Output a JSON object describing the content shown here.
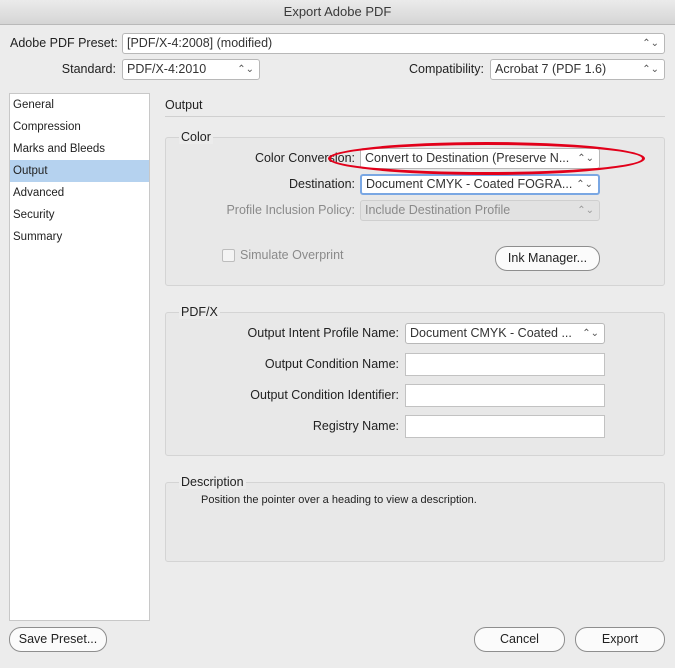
{
  "window": {
    "title": "Export Adobe PDF"
  },
  "header": {
    "preset_label": "Adobe PDF Preset:",
    "preset_value": "[PDF/X-4:2008] (modified)",
    "standard_label": "Standard:",
    "standard_value": "PDF/X-4:2010",
    "compat_label": "Compatibility:",
    "compat_value": "Acrobat 7 (PDF 1.6)"
  },
  "sidebar": {
    "items": [
      {
        "label": "General"
      },
      {
        "label": "Compression"
      },
      {
        "label": "Marks and Bleeds"
      },
      {
        "label": "Output"
      },
      {
        "label": "Advanced"
      },
      {
        "label": "Security"
      },
      {
        "label": "Summary"
      }
    ],
    "selected": "Output"
  },
  "main": {
    "section_title": "Output",
    "color": {
      "title": "Color",
      "conversion_label": "Color Conversion:",
      "conversion_value": "Convert to Destination (Preserve N...",
      "destination_label": "Destination:",
      "destination_value": "Document CMYK - Coated FOGRA...",
      "policy_label": "Profile Inclusion Policy:",
      "policy_value": "Include Destination Profile",
      "simulate_label": "Simulate Overprint",
      "ink_manager_label": "Ink Manager..."
    },
    "pdfx": {
      "title": "PDF/X",
      "intent_label": "Output Intent Profile Name:",
      "intent_value": "Document CMYK - Coated ...",
      "condition_name_label": "Output Condition Name:",
      "condition_name_value": "",
      "condition_id_label": "Output Condition Identifier:",
      "condition_id_value": "",
      "registry_label": "Registry Name:",
      "registry_value": ""
    },
    "description": {
      "title": "Description",
      "text": "Position the pointer over a heading to view a description."
    }
  },
  "footer": {
    "save_preset_label": "Save Preset...",
    "cancel_label": "Cancel",
    "export_label": "Export"
  },
  "icons": {
    "chevron": "chevron-updown-icon"
  },
  "colors": {
    "selection": "#b5d2ef",
    "annotation_oval": "#e2001a",
    "focus_ring": "#7aa7e3"
  }
}
